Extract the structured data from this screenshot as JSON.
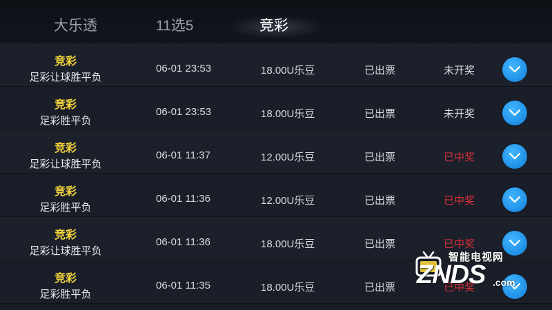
{
  "tabs": [
    {
      "label": "大乐透",
      "active": false
    },
    {
      "label": "11选5",
      "active": false
    },
    {
      "label": "竞彩",
      "active": true
    }
  ],
  "records": [
    {
      "lottery": "竞彩",
      "play_type": "足彩让球胜平负",
      "time": "06-01 23:53",
      "amount": "18.00U乐豆",
      "ticket_status": "已出票",
      "prize_status": "未开奖",
      "won": false
    },
    {
      "lottery": "竞彩",
      "play_type": "足彩胜平负",
      "time": "06-01 23:53",
      "amount": "18.00U乐豆",
      "ticket_status": "已出票",
      "prize_status": "未开奖",
      "won": false
    },
    {
      "lottery": "竞彩",
      "play_type": "足彩让球胜平负",
      "time": "06-01 11:37",
      "amount": "12.00U乐豆",
      "ticket_status": "已出票",
      "prize_status": "已中奖",
      "won": true
    },
    {
      "lottery": "竞彩",
      "play_type": "足彩胜平负",
      "time": "06-01 11:36",
      "amount": "12.00U乐豆",
      "ticket_status": "已出票",
      "prize_status": "已中奖",
      "won": true
    },
    {
      "lottery": "竞彩",
      "play_type": "足彩让球胜平负",
      "time": "06-01 11:36",
      "amount": "18.00U乐豆",
      "ticket_status": "已出票",
      "prize_status": "已中奖",
      "won": true
    },
    {
      "lottery": "竞彩",
      "play_type": "足彩胜平负",
      "time": "06-01 11:35",
      "amount": "18.00U乐豆",
      "ticket_status": "已出票",
      "prize_status": "已中奖",
      "won": true
    }
  ],
  "watermark": {
    "cn_text": "智能电视网",
    "logo_text": "ZNDS",
    "domain_suffix": ".com"
  },
  "colors": {
    "background": "#181c26",
    "lottery_name": "#f3d33c",
    "won_status": "#d6303a",
    "expand_button": "#1f8fe6"
  }
}
